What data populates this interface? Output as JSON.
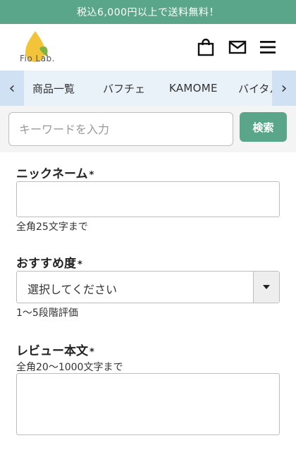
{
  "banner": {
    "text": "税込6,000円以上で送料無料！",
    "color": "#5aa68a"
  },
  "header": {
    "logo_text": "Fio Lab.",
    "icons": [
      "shopping-bag-icon",
      "mail-icon",
      "hamburger-menu-icon"
    ]
  },
  "nav": {
    "prev": "‹",
    "next": "›",
    "items": [
      "商品一覧",
      "バフチェ",
      "KAMOME",
      "バイタル"
    ]
  },
  "search": {
    "placeholder": "キーワードを入力",
    "button_label": "検索"
  },
  "form": {
    "nickname": {
      "label": "ニックネーム",
      "required_mark": "*",
      "hint": "全角25文字まで"
    },
    "rating": {
      "label": "おすすめ度",
      "required_mark": "*",
      "selected": "選択してください",
      "hint": "1〜5段階評価"
    },
    "review": {
      "label": "レビュー本文",
      "required_mark": "*",
      "hint": "全角20〜1000文字まで"
    }
  }
}
